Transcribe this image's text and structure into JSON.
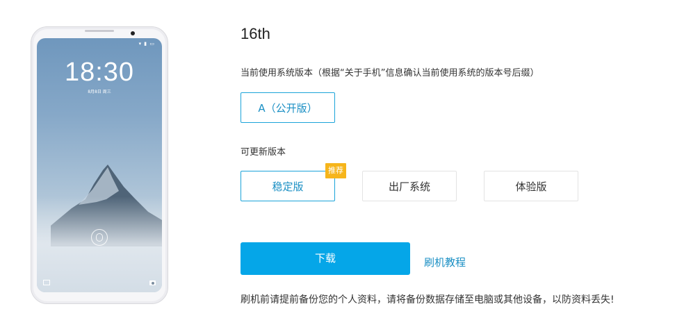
{
  "phone": {
    "status_icons": "▾ ▮ ▭",
    "time": "18:30",
    "date": "8月8日 周三"
  },
  "device": {
    "model": "16th"
  },
  "current_version": {
    "label": "当前使用系统版本（根据“关于手机”信息确认当前使用系统的版本号后缀）",
    "selected": "A（公开版）"
  },
  "updates": {
    "label": "可更新版本",
    "options": [
      "稳定版",
      "出厂系统",
      "体验版"
    ],
    "selected_index": 0,
    "recommend_badge": "推荐"
  },
  "actions": {
    "download": "下载",
    "tutorial": "刷机教程"
  },
  "note": "刷机前请提前备份您的个人资料，请将备份数据存储至电脑或其他设备，以防资料丢失!",
  "colors": {
    "accent": "#1aa3d9",
    "download_bg": "#05a6e8",
    "badge": "#f6b51b"
  }
}
